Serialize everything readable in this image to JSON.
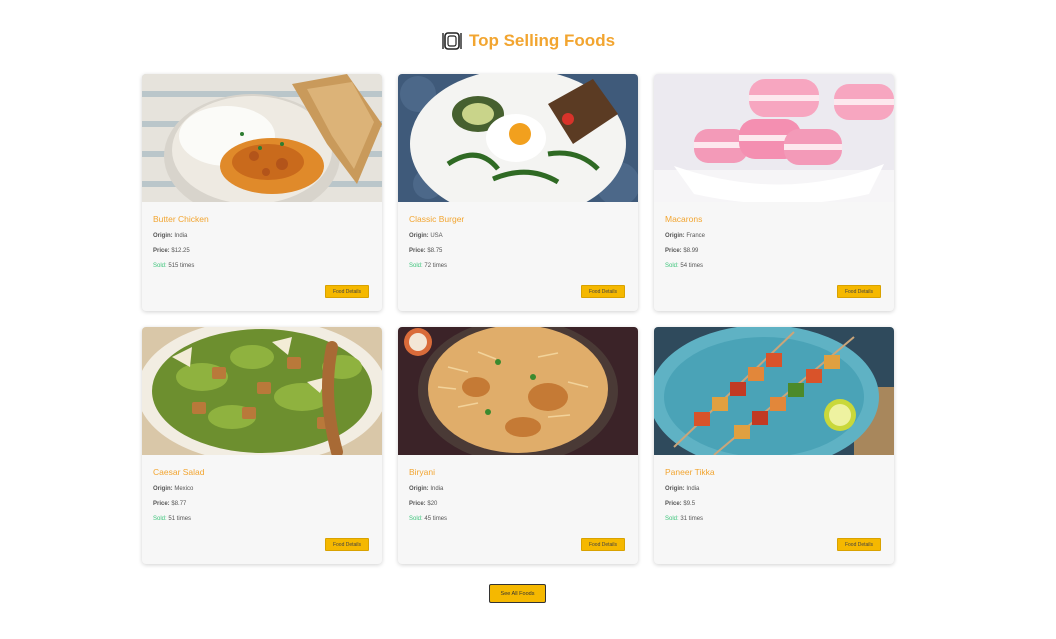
{
  "section": {
    "title": "Top Selling Foods",
    "icon": "plate-cutlery-icon",
    "accent_color": "#f2a530",
    "button_color": "#f5b800",
    "sold_color": "#3cc47a"
  },
  "labels": {
    "origin": "Origin:",
    "price": "Price:",
    "sold": "Sold:",
    "details_button": "Food Details"
  },
  "foods": [
    {
      "name": "Butter Chicken",
      "origin": "India",
      "price": "$12.25",
      "sold": "515 times",
      "image": "butter-chicken-photo"
    },
    {
      "name": "Classic Burger",
      "origin": "USA",
      "price": "$8.75",
      "sold": "72 times",
      "image": "egg-salad-plate-photo"
    },
    {
      "name": "Macarons",
      "origin": "France",
      "price": "$8.99",
      "sold": "54 times",
      "image": "pink-macarons-photo"
    },
    {
      "name": "Caesar Salad",
      "origin": "Mexico",
      "price": "$8.77",
      "sold": "51 times",
      "image": "caesar-salad-photo"
    },
    {
      "name": "Biryani",
      "origin": "India",
      "price": "$20",
      "sold": "45 times",
      "image": "biryani-photo"
    },
    {
      "name": "Paneer Tikka",
      "origin": "India",
      "price": "$9.5",
      "sold": "31 times",
      "image": "paneer-tikka-photo"
    }
  ],
  "footer": {
    "see_all_label": "See All Foods"
  }
}
